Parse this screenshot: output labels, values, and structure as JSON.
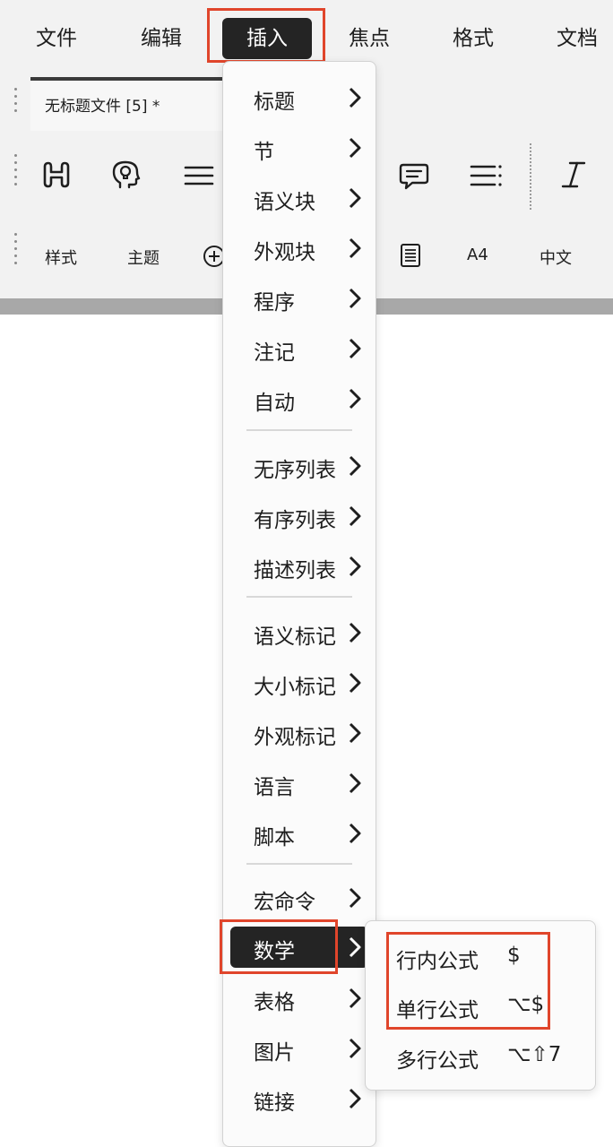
{
  "menubar": {
    "items": [
      {
        "label": "文件"
      },
      {
        "label": "编辑"
      },
      {
        "label": "插入",
        "active": true
      },
      {
        "label": "焦点"
      },
      {
        "label": "格式"
      },
      {
        "label": "文档"
      }
    ]
  },
  "tab": {
    "title": "无标题文件 [5] *"
  },
  "toolbar": {
    "icons": [
      "heading-icon",
      "lightbulb-head-icon",
      "align-lines-icon",
      "comment-icon",
      "list-icon",
      "italic-icon"
    ],
    "bottom_labels": {
      "style": "样式",
      "theme": "主题",
      "paper": "A4",
      "language": "中文"
    },
    "bottom_icons": [
      "add-circle-icon",
      "document-icon"
    ]
  },
  "insert_menu": {
    "groups": [
      [
        "标题",
        "节",
        "语义块",
        "外观块",
        "程序",
        "注记",
        "自动"
      ],
      [
        "无序列表",
        "有序列表",
        "描述列表"
      ],
      [
        "语义标记",
        "大小标记",
        "外观标记",
        "语言",
        "脚本"
      ],
      [
        "宏命令",
        "数学",
        "表格",
        "图片",
        "链接"
      ]
    ],
    "active_item": "数学"
  },
  "math_submenu": {
    "items": [
      {
        "label": "行内公式",
        "shortcut": "$"
      },
      {
        "label": "单行公式",
        "shortcut": "⌥$"
      },
      {
        "label": "多行公式",
        "shortcut": "⌥⇧7"
      }
    ]
  },
  "colors": {
    "highlight": "#e0452b",
    "active_bg": "#242424",
    "chrome_bg": "#f2f2f2"
  }
}
